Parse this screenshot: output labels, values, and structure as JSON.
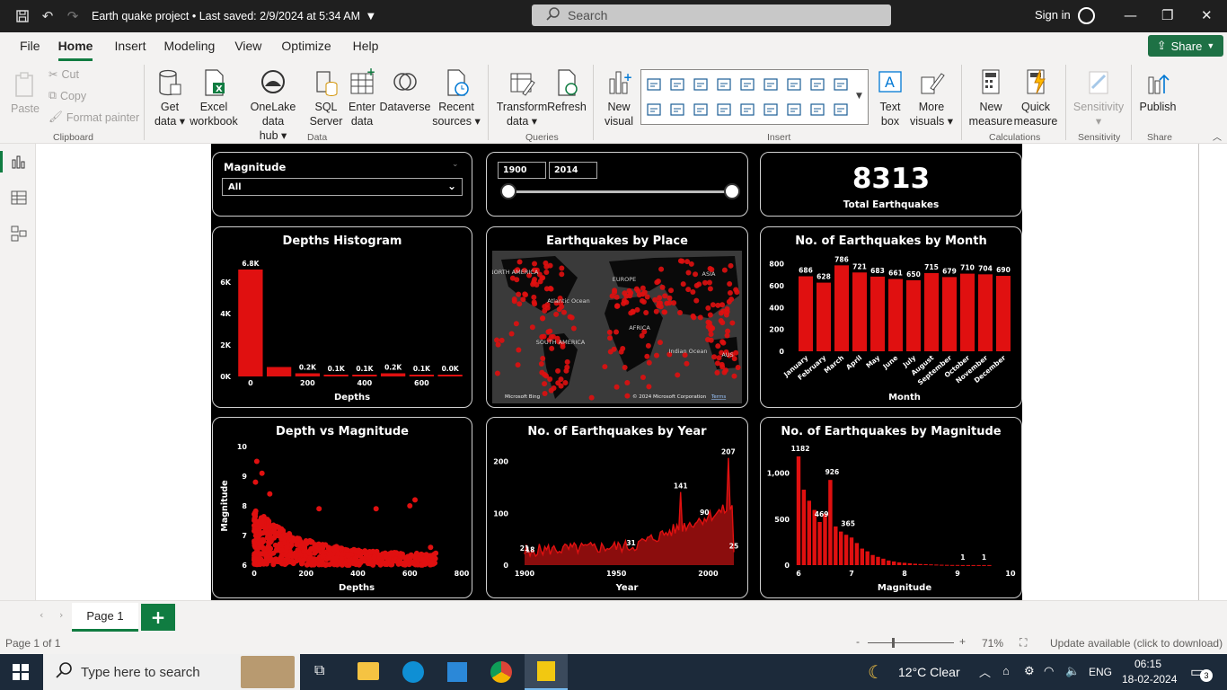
{
  "titlebar": {
    "document_title": "Earth quake project • Last saved: 2/9/2024 at 5:34 AM",
    "search_placeholder": "Search",
    "sign_in": "Sign in"
  },
  "menu": {
    "tabs": [
      "File",
      "Home",
      "Insert",
      "Modeling",
      "View",
      "Optimize",
      "Help"
    ],
    "active": "Home",
    "share_label": "Share"
  },
  "ribbon": {
    "clipboard": {
      "paste": "Paste",
      "cut": "Cut",
      "copy": "Copy",
      "format_painter": "Format painter",
      "group": "Clipboard"
    },
    "data": {
      "get_data": [
        "Get",
        "data"
      ],
      "excel": [
        "Excel",
        "workbook"
      ],
      "onelake": [
        "OneLake data",
        "hub"
      ],
      "sql": [
        "SQL",
        "Server"
      ],
      "enter": [
        "Enter",
        "data"
      ],
      "dataverse": "Dataverse",
      "recent": [
        "Recent",
        "sources"
      ],
      "group": "Data"
    },
    "queries": {
      "transform": [
        "Transform",
        "data"
      ],
      "refresh": "Refresh",
      "group": "Queries"
    },
    "insert": {
      "new_visual": [
        "New",
        "visual"
      ],
      "text_box": [
        "Text",
        "box"
      ],
      "more_visuals": [
        "More",
        "visuals"
      ],
      "group": "Insert"
    },
    "calculations": {
      "new_measure": [
        "New",
        "measure"
      ],
      "quick_measure": [
        "Quick",
        "measure"
      ],
      "group": "Calculations"
    },
    "sensitivity": {
      "label": "Sensitivity",
      "group": "Sensitivity"
    },
    "share": {
      "publish": "Publish",
      "group": "Share"
    }
  },
  "slicer_magnitude": {
    "title": "Magnitude",
    "value": "All"
  },
  "slicer_year": {
    "from": "1900",
    "to": "2014"
  },
  "kpi": {
    "value": "8313",
    "label": "Total Earthquakes"
  },
  "visuals": {
    "depths_histogram": {
      "title": "Depths Histogram",
      "xlabel": "Depths"
    },
    "map": {
      "title": "Earthquakes by Place",
      "labels": [
        "NORTH AMERICA",
        "EUROPE",
        "ASIA",
        "Atlantic Ocean",
        "AFRICA",
        "SOUTH AMERICA",
        "Indian Ocean",
        "AUS"
      ],
      "credit_left": "Microsoft Bing",
      "credit_right": "© 2024 Microsoft Corporation",
      "terms": "Terms"
    },
    "by_month": {
      "title": "No. of Earthquakes by Month",
      "xlabel": "Month"
    },
    "depth_vs_mag": {
      "title": "Depth vs Magnitude",
      "xlabel": "Depths",
      "ylabel": "Magnitude"
    },
    "by_year": {
      "title": "No. of Earthquakes by Year",
      "xlabel": "Year"
    },
    "by_magnitude": {
      "title": "No. of Earthquakes by Magnitude",
      "xlabel": "Magnitude"
    }
  },
  "chart_data": [
    {
      "type": "bar",
      "name": "depths_histogram",
      "x": [
        0,
        100,
        200,
        300,
        400,
        500,
        600,
        700
      ],
      "values": [
        6800,
        600,
        200,
        100,
        100,
        200,
        100,
        0
      ],
      "data_labels": [
        "6.8K",
        "",
        "0.2K",
        "0.1K",
        "0.1K",
        "0.2K",
        "0.1K",
        "0.0K"
      ],
      "yticks": [
        "0K",
        "2K",
        "4K",
        "6K"
      ],
      "xticks": [
        "0",
        "200",
        "400",
        "600"
      ],
      "ylim": [
        0,
        7200
      ]
    },
    {
      "type": "bar",
      "name": "by_month",
      "categories": [
        "January",
        "February",
        "March",
        "April",
        "May",
        "June",
        "July",
        "August",
        "September",
        "October",
        "November",
        "December"
      ],
      "values": [
        686,
        628,
        786,
        721,
        683,
        661,
        650,
        715,
        679,
        710,
        704,
        690
      ],
      "yticks": [
        "0",
        "200",
        "400",
        "600",
        "800"
      ],
      "ylim": [
        0,
        830
      ]
    },
    {
      "type": "scatter",
      "name": "depth_vs_mag",
      "xlim": [
        0,
        800
      ],
      "ylim": [
        6,
        10
      ],
      "xticks": [
        "0",
        "200",
        "400",
        "600",
        "800"
      ],
      "yticks": [
        "6",
        "7",
        "8",
        "9",
        "10"
      ]
    },
    {
      "type": "area",
      "name": "by_year",
      "xlim": [
        1900,
        2014
      ],
      "ylim": [
        0,
        215
      ],
      "xticks": [
        "1900",
        "1950",
        "2000"
      ],
      "yticks": [
        "0",
        "100",
        "200"
      ],
      "annotations": [
        {
          "x": 1900,
          "y": 21,
          "label": "21"
        },
        {
          "x": 1903,
          "y": 18,
          "label": "18"
        },
        {
          "x": 1958,
          "y": 31,
          "label": "31"
        },
        {
          "x": 1985,
          "y": 141,
          "label": "141"
        },
        {
          "x": 1998,
          "y": 90,
          "label": "90"
        },
        {
          "x": 2011,
          "y": 207,
          "label": "207"
        },
        {
          "x": 2014,
          "y": 25,
          "label": "25"
        }
      ]
    },
    {
      "type": "bar",
      "name": "by_magnitude",
      "xlim": [
        6,
        10
      ],
      "ylim": [
        0,
        1250
      ],
      "xticks": [
        "6",
        "7",
        "8",
        "9",
        "10"
      ],
      "yticks": [
        "0",
        "500",
        "1,000"
      ],
      "annotations": [
        {
          "x": 6.0,
          "y": 1182,
          "label": "1182"
        },
        {
          "x": 6.4,
          "y": 469,
          "label": "469"
        },
        {
          "x": 6.6,
          "y": 926,
          "label": "926"
        },
        {
          "x": 6.9,
          "y": 365,
          "label": "365"
        },
        {
          "x": 9.1,
          "y": 1,
          "label": "1"
        },
        {
          "x": 9.5,
          "y": 1,
          "label": "1"
        }
      ]
    }
  ],
  "pages": {
    "tab": "Page 1",
    "add": "+"
  },
  "status": {
    "page": "Page 1 of 1",
    "zoom": "71%",
    "update": "Update available (click to download)"
  },
  "taskbar": {
    "search": "Type here to search",
    "weather": "12°C  Clear",
    "lang": "ENG",
    "time": "06:15",
    "date": "18-02-2024",
    "notif": "3"
  }
}
